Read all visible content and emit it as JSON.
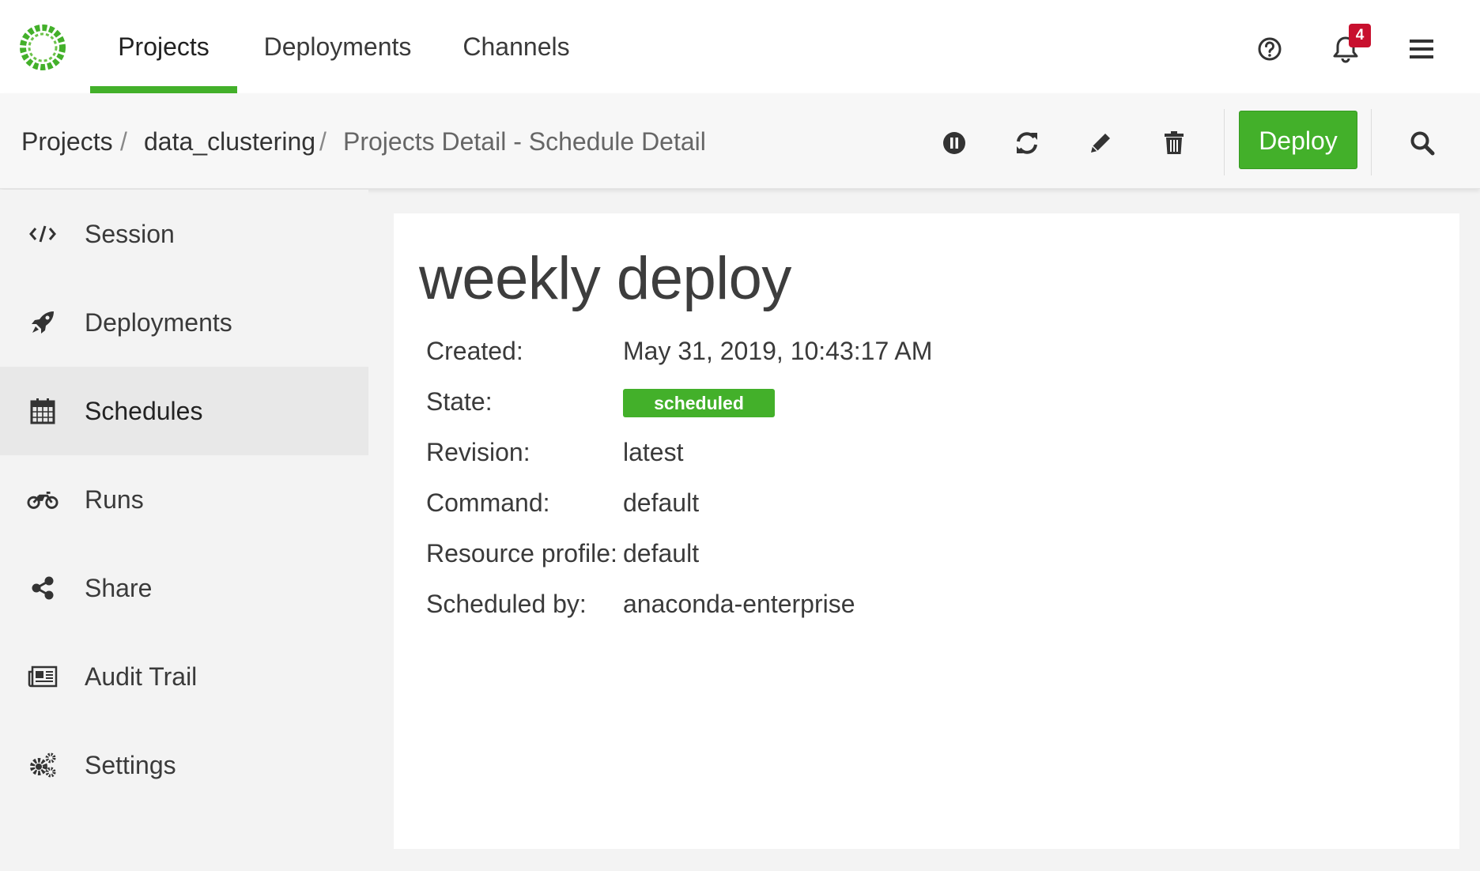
{
  "nav": {
    "tabs": [
      {
        "label": "Projects",
        "active": true
      },
      {
        "label": "Deployments",
        "active": false
      },
      {
        "label": "Channels",
        "active": false
      }
    ],
    "notification_count": "4",
    "icons": [
      "logo-icon",
      "help-icon",
      "bell-icon",
      "hamburger-menu-icon"
    ]
  },
  "breadcrumb": {
    "items": [
      "Projects",
      "data_clustering",
      "Projects Detail - Schedule Detail"
    ],
    "separator": "/"
  },
  "toolbar": {
    "deploy_label": "Deploy",
    "icons": [
      "pause-icon",
      "refresh-icon",
      "edit-icon",
      "trash-icon",
      "search-icon"
    ]
  },
  "sidebar": {
    "items": [
      {
        "label": "Session",
        "icon": "code-icon",
        "active": false
      },
      {
        "label": "Deployments",
        "icon": "rocket-icon",
        "active": false
      },
      {
        "label": "Schedules",
        "icon": "calendar-icon",
        "active": true
      },
      {
        "label": "Runs",
        "icon": "motorcycle-icon",
        "active": false
      },
      {
        "label": "Share",
        "icon": "share-icon",
        "active": false
      },
      {
        "label": "Audit Trail",
        "icon": "newspaper-icon",
        "active": false
      },
      {
        "label": "Settings",
        "icon": "gears-icon",
        "active": false
      }
    ]
  },
  "schedule": {
    "title": "weekly deploy",
    "fields": [
      {
        "label": "Created:",
        "value": "May 31, 2019, 10:43:17 AM"
      },
      {
        "label": "State:",
        "value": "scheduled"
      },
      {
        "label": "Revision:",
        "value": "latest"
      },
      {
        "label": "Command:",
        "value": "default"
      },
      {
        "label": "Resource profile:",
        "value": "default"
      },
      {
        "label": "Scheduled by:",
        "value": "anaconda-enterprise"
      }
    ]
  },
  "colors": {
    "accent_green": "#43b02a",
    "badge_red": "#c8102e",
    "sidebar_active": "#e8e8e8"
  }
}
